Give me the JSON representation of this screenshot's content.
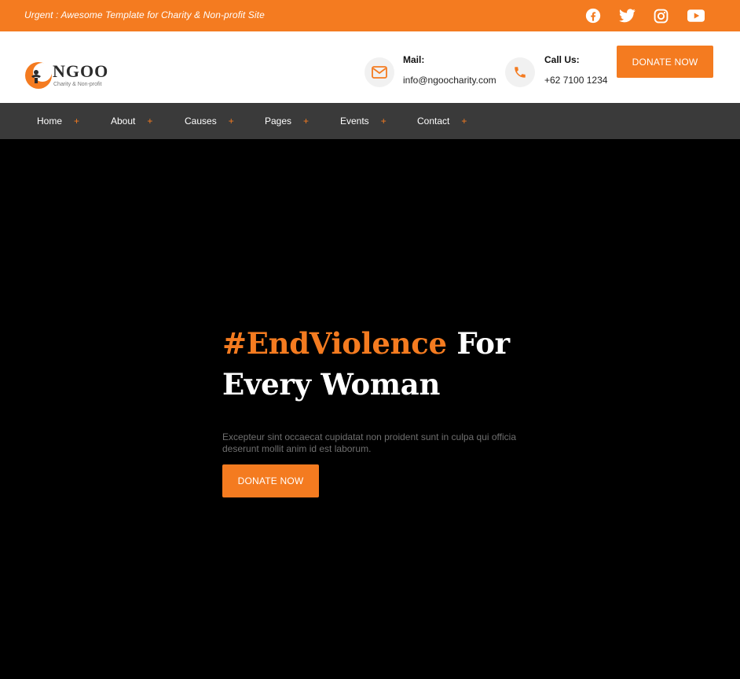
{
  "topbar": {
    "urgent_text": "Urgent : Awesome Template for Charity & Non-profit Site",
    "social": [
      "facebook-icon",
      "twitter-icon",
      "instagram-icon",
      "youtube-icon"
    ]
  },
  "brand": {
    "name": "NGOO",
    "tagline": "Charity & Non-profit"
  },
  "contact": {
    "mail_label": "Mail:",
    "mail_value": "info@ngoocharity.com",
    "call_label": "Call Us:",
    "call_value": "+62 7100 1234"
  },
  "header": {
    "donate_label": "DONATE NOW"
  },
  "nav": {
    "items": [
      {
        "label": "Home"
      },
      {
        "label": "About"
      },
      {
        "label": "Causes"
      },
      {
        "label": "Pages"
      },
      {
        "label": "Events"
      },
      {
        "label": "Contact"
      }
    ],
    "expand_symbol": "+"
  },
  "hero": {
    "title_accent": "#EndViolence",
    "title_rest_1": " For",
    "title_rest_2": "Every Woman",
    "text": "Excepteur sint occaecat cupidatat non proident sunt in culpa qui officia deserunt mollit anim id est laborum.",
    "donate_label": "DONATE NOW"
  },
  "colors": {
    "accent": "#F47B20",
    "nav_bg": "#3A3A3A",
    "hero_bg": "#000000"
  }
}
